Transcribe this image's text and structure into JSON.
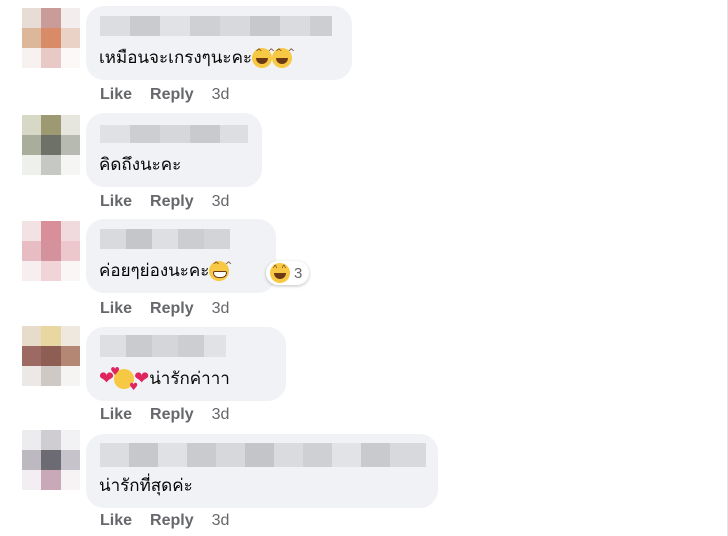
{
  "comments": [
    {
      "text": "เหมือนจะเกรงๆนะคะ",
      "emoji": [
        "laugh-emoji",
        "laugh-emoji"
      ],
      "like": "Like",
      "reply": "Reply",
      "time": "3d"
    },
    {
      "text": "คิดถึงนะคะ",
      "emoji": [],
      "like": "Like",
      "reply": "Reply",
      "time": "3d"
    },
    {
      "text": "ค่อยๆย่องนะคะ",
      "emoji": [
        "grin-emoji"
      ],
      "like": "Like",
      "reply": "Reply",
      "time": "3d",
      "reaction": {
        "icon": "laughing-reaction-icon",
        "count": "3"
      }
    },
    {
      "text": "น่ารักค่าาา",
      "emoji_prefix": [
        "heart-emoji",
        "love-face-emoji",
        "heart-emoji"
      ],
      "like": "Like",
      "reply": "Reply",
      "time": "3d"
    },
    {
      "text": "น่ารักที่สุดค่ะ",
      "emoji": [],
      "like": "Like",
      "reply": "Reply",
      "time": "3d"
    }
  ],
  "colors": {
    "bubble": "#f0f2f5",
    "action": "#65676b",
    "text": "#050505",
    "heart": "#e0245e",
    "emoji": "#f7c843"
  }
}
